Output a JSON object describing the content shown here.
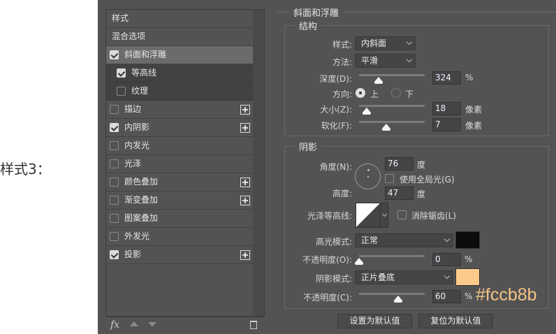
{
  "caption": "样式3：",
  "styles_list": {
    "items": [
      {
        "label": "样式",
        "checkbox": null,
        "plus": false,
        "kind": "plain"
      },
      {
        "label": "混合选项",
        "checkbox": null,
        "plus": false,
        "kind": "plain"
      },
      {
        "label": "斜面和浮雕",
        "checkbox": true,
        "plus": false,
        "kind": "sel"
      },
      {
        "label": "等高线",
        "checkbox": true,
        "plus": false,
        "kind": "sub"
      },
      {
        "label": "纹理",
        "checkbox": false,
        "plus": false,
        "kind": "sub"
      },
      {
        "label": "描边",
        "checkbox": false,
        "plus": true,
        "kind": ""
      },
      {
        "label": "内阴影",
        "checkbox": true,
        "plus": true,
        "kind": ""
      },
      {
        "label": "内发光",
        "checkbox": false,
        "plus": false,
        "kind": ""
      },
      {
        "label": "光泽",
        "checkbox": false,
        "plus": false,
        "kind": ""
      },
      {
        "label": "颜色叠加",
        "checkbox": false,
        "plus": true,
        "kind": ""
      },
      {
        "label": "渐变叠加",
        "checkbox": false,
        "plus": true,
        "kind": ""
      },
      {
        "label": "图案叠加",
        "checkbox": false,
        "plus": false,
        "kind": ""
      },
      {
        "label": "外发光",
        "checkbox": false,
        "plus": false,
        "kind": ""
      },
      {
        "label": "投影",
        "checkbox": true,
        "plus": true,
        "kind": ""
      }
    ],
    "toolbar": {
      "fx": "fx"
    }
  },
  "bevel": {
    "title": "斜面和浮雕",
    "structure": {
      "title": "结构",
      "style_label": "样式:",
      "style_value": "内斜面",
      "technique_label": "方法:",
      "technique_value": "平滑",
      "depth_label": "深度(D):",
      "depth_value": "324",
      "depth_unit": "%",
      "depth_slider": 0.3,
      "direction_label": "方向:",
      "dir_up": "上",
      "dir_down": "下",
      "size_label": "大小(Z):",
      "size_value": "18",
      "size_unit": "像素",
      "size_slider": 0.12,
      "soften_label": "软化(F):",
      "soften_value": "7",
      "soften_unit": "像素",
      "soften_slider": 0.42
    },
    "shading": {
      "title": "阴影",
      "angle_label": "角度(N):",
      "angle_value": "76",
      "angle_unit": "度",
      "global_light_label": "使用全局光(G)",
      "altitude_label": "高度:",
      "altitude_value": "47",
      "altitude_unit": "度",
      "gloss_label": "光泽等高线:",
      "antialias_label": "消除锯齿(L)",
      "highlight_label": "高光模式:",
      "highlight_value": "正常",
      "highlight_color": "#0c0c0c",
      "hl_opacity_label": "不透明度(O):",
      "hl_opacity_value": "0",
      "hl_opacity_unit": "%",
      "hl_opacity_slider": 0,
      "shadow_label": "阴影模式:",
      "shadow_value": "正片叠底",
      "shadow_color": "#fccb8b",
      "sh_opacity_label": "不透明度(C):",
      "sh_opacity_value": "60",
      "sh_opacity_unit": "%",
      "sh_opacity_slider": 0.6
    },
    "make_default": "设置为默认值",
    "reset_default": "复位为默认值"
  },
  "annotation": "#fccb8b"
}
